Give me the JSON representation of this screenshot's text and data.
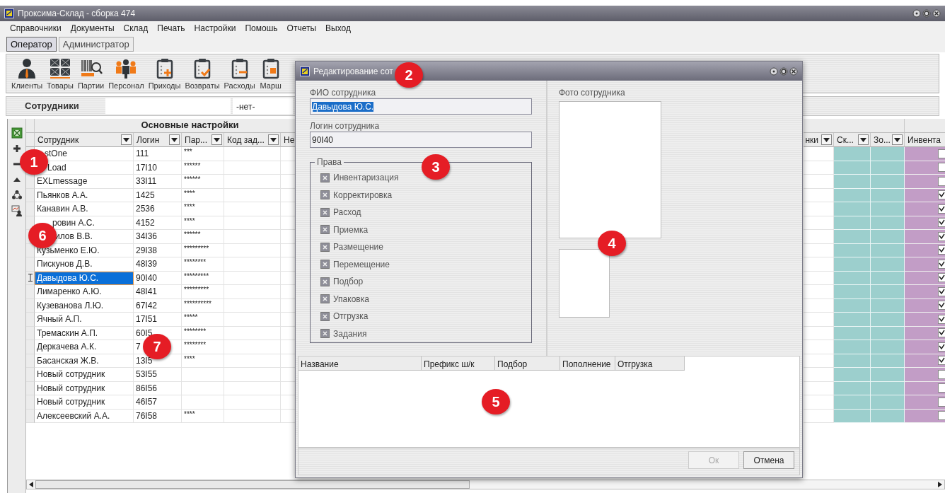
{
  "window": {
    "title": "Проксима-Склад - сборка 474"
  },
  "menu": [
    "Справочники",
    "Документы",
    "Склад",
    "Печать",
    "Настройки",
    "Помошь",
    "Отчеты",
    "Выход"
  ],
  "mode_tabs": [
    {
      "label": "Оператор",
      "selected": true
    },
    {
      "label": "Администратор",
      "selected": false
    }
  ],
  "toolbar": [
    {
      "label": "Клиенты",
      "kind": "client"
    },
    {
      "label": "Товары",
      "kind": "goods"
    },
    {
      "label": "Партии",
      "kind": "batches"
    },
    {
      "label": "Персонал",
      "kind": "staff"
    },
    {
      "label": "Приходы",
      "kind": "incoming"
    },
    {
      "label": "Возвраты",
      "kind": "returns"
    },
    {
      "label": "Расходы",
      "kind": "outgoing"
    },
    {
      "label": "Марш",
      "kind": "route"
    }
  ],
  "filter_bar": {
    "title": "Сотрудники",
    "combo_value": "-нет-"
  },
  "grid": {
    "group_header": "Основные настройки",
    "columns": [
      "Сотрудник",
      "Логин",
      "Пар...",
      "Код зад...",
      "Не"
    ],
    "right_columns": [
      "нки",
      "Ск...",
      "Зо...",
      "Инвента"
    ],
    "rows": [
      {
        "name": "stOne",
        "login": "111",
        "password": "***",
        "selected": false,
        "inventory": false
      },
      {
        "name": "Load",
        "login": "17I10",
        "password": "******",
        "selected": false,
        "inventory": false
      },
      {
        "name": "EXLmessage",
        "login": "33I11",
        "password": "******",
        "selected": false,
        "inventory": false
      },
      {
        "name": "Пьянков А.А.",
        "login": "1425",
        "password": "****",
        "selected": false,
        "inventory": true
      },
      {
        "name": "Канавин А.В.",
        "login": "2536",
        "password": "****",
        "selected": false,
        "inventory": true
      },
      {
        "name": "ровин А.С.",
        "login": "4152",
        "password": "****",
        "selected": false,
        "inventory": true
      },
      {
        "name": "илов В.В.",
        "login": "34I36",
        "password": "******",
        "selected": false,
        "inventory": true
      },
      {
        "name": "Кузьменко Е.Ю.",
        "login": "29I38",
        "password": "*********",
        "selected": false,
        "inventory": true
      },
      {
        "name": "Пискунов Д.В.",
        "login": "48I39",
        "password": "********",
        "selected": false,
        "inventory": true
      },
      {
        "name": "Давыдова Ю.С.",
        "login": "90I40",
        "password": "*********",
        "selected": true,
        "inventory": true
      },
      {
        "name": "Лимаренко А.Ю.",
        "login": "48I41",
        "password": "*********",
        "selected": false,
        "inventory": true
      },
      {
        "name": "Кузеванова Л.Ю.",
        "login": "67I42",
        "password": "**********",
        "selected": false,
        "inventory": true
      },
      {
        "name": "Ячный А.П.",
        "login": "17I51",
        "password": "*****",
        "selected": false,
        "inventory": true
      },
      {
        "name": "Тремаскин А.П.",
        "login": "60I5",
        "password": "********",
        "selected": false,
        "inventory": true
      },
      {
        "name": "Деркачева А.К.",
        "login": "7",
        "password": "********",
        "selected": false,
        "inventory": true
      },
      {
        "name": "Басанская Ж.В.",
        "login": "13I5",
        "password": "****",
        "selected": false,
        "inventory": true
      },
      {
        "name": "Новый сотрудник",
        "login": "53I55",
        "selected": false,
        "inventory": false
      },
      {
        "name": "Новый сотрудник",
        "login": "86I56",
        "selected": false,
        "inventory": false
      },
      {
        "name": "Новый сотрудник",
        "login": "46I57",
        "selected": false,
        "inventory": false
      },
      {
        "name": "Алексеевский А.А.",
        "login": "76I58",
        "password": "****",
        "selected": false,
        "inventory": false
      }
    ]
  },
  "dialog": {
    "title": "Редактирование сот",
    "fio_label": "ФИО сотрудника",
    "fio_value": "Давыдова Ю.С.",
    "fio_value_selected": true,
    "login_label": "Логин сотрудника",
    "login_value": "90I40",
    "rights_title": "Права",
    "rights": [
      {
        "label": "Инвентаризация",
        "checked": true
      },
      {
        "label": "Корректировка",
        "checked": true
      },
      {
        "label": "Расход",
        "checked": true
      },
      {
        "label": "Приемка",
        "checked": true
      },
      {
        "label": "Размещение",
        "checked": true
      },
      {
        "label": "Перемещение",
        "checked": true
      },
      {
        "label": "Подбор",
        "checked": true
      },
      {
        "label": "Упаковка",
        "checked": true
      },
      {
        "label": "Отгрузка",
        "checked": true
      },
      {
        "label": "Задания",
        "checked": true
      }
    ],
    "photo_label": "Фото сотрудника",
    "table_columns": [
      "Название",
      "Префикс ш/к",
      "Подбор",
      "Пополнение",
      "Отгрузка"
    ],
    "buttons": [
      {
        "label": "Ок",
        "disabled": true
      },
      {
        "label": "Отмена",
        "disabled": false
      }
    ]
  },
  "callouts": [
    {
      "label": "1"
    },
    {
      "label": "2"
    },
    {
      "label": "3"
    },
    {
      "label": "4"
    },
    {
      "label": "5"
    },
    {
      "label": "6"
    },
    {
      "label": "7"
    }
  ]
}
